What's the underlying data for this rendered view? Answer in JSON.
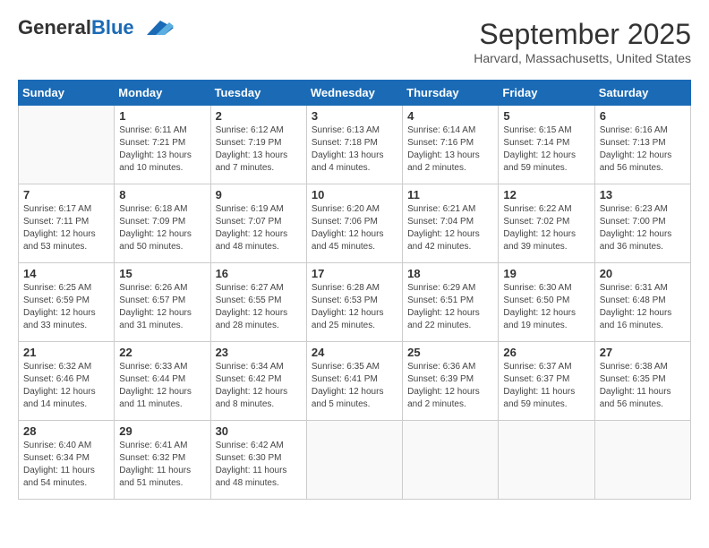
{
  "logo": {
    "general": "General",
    "blue": "Blue"
  },
  "title": "September 2025",
  "location": "Harvard, Massachusetts, United States",
  "days_of_week": [
    "Sunday",
    "Monday",
    "Tuesday",
    "Wednesday",
    "Thursday",
    "Friday",
    "Saturday"
  ],
  "weeks": [
    [
      {
        "day": "",
        "sunrise": "",
        "sunset": "",
        "daylight": ""
      },
      {
        "day": "1",
        "sunrise": "Sunrise: 6:11 AM",
        "sunset": "Sunset: 7:21 PM",
        "daylight": "Daylight: 13 hours and 10 minutes."
      },
      {
        "day": "2",
        "sunrise": "Sunrise: 6:12 AM",
        "sunset": "Sunset: 7:19 PM",
        "daylight": "Daylight: 13 hours and 7 minutes."
      },
      {
        "day": "3",
        "sunrise": "Sunrise: 6:13 AM",
        "sunset": "Sunset: 7:18 PM",
        "daylight": "Daylight: 13 hours and 4 minutes."
      },
      {
        "day": "4",
        "sunrise": "Sunrise: 6:14 AM",
        "sunset": "Sunset: 7:16 PM",
        "daylight": "Daylight: 13 hours and 2 minutes."
      },
      {
        "day": "5",
        "sunrise": "Sunrise: 6:15 AM",
        "sunset": "Sunset: 7:14 PM",
        "daylight": "Daylight: 12 hours and 59 minutes."
      },
      {
        "day": "6",
        "sunrise": "Sunrise: 6:16 AM",
        "sunset": "Sunset: 7:13 PM",
        "daylight": "Daylight: 12 hours and 56 minutes."
      }
    ],
    [
      {
        "day": "7",
        "sunrise": "Sunrise: 6:17 AM",
        "sunset": "Sunset: 7:11 PM",
        "daylight": "Daylight: 12 hours and 53 minutes."
      },
      {
        "day": "8",
        "sunrise": "Sunrise: 6:18 AM",
        "sunset": "Sunset: 7:09 PM",
        "daylight": "Daylight: 12 hours and 50 minutes."
      },
      {
        "day": "9",
        "sunrise": "Sunrise: 6:19 AM",
        "sunset": "Sunset: 7:07 PM",
        "daylight": "Daylight: 12 hours and 48 minutes."
      },
      {
        "day": "10",
        "sunrise": "Sunrise: 6:20 AM",
        "sunset": "Sunset: 7:06 PM",
        "daylight": "Daylight: 12 hours and 45 minutes."
      },
      {
        "day": "11",
        "sunrise": "Sunrise: 6:21 AM",
        "sunset": "Sunset: 7:04 PM",
        "daylight": "Daylight: 12 hours and 42 minutes."
      },
      {
        "day": "12",
        "sunrise": "Sunrise: 6:22 AM",
        "sunset": "Sunset: 7:02 PM",
        "daylight": "Daylight: 12 hours and 39 minutes."
      },
      {
        "day": "13",
        "sunrise": "Sunrise: 6:23 AM",
        "sunset": "Sunset: 7:00 PM",
        "daylight": "Daylight: 12 hours and 36 minutes."
      }
    ],
    [
      {
        "day": "14",
        "sunrise": "Sunrise: 6:25 AM",
        "sunset": "Sunset: 6:59 PM",
        "daylight": "Daylight: 12 hours and 33 minutes."
      },
      {
        "day": "15",
        "sunrise": "Sunrise: 6:26 AM",
        "sunset": "Sunset: 6:57 PM",
        "daylight": "Daylight: 12 hours and 31 minutes."
      },
      {
        "day": "16",
        "sunrise": "Sunrise: 6:27 AM",
        "sunset": "Sunset: 6:55 PM",
        "daylight": "Daylight: 12 hours and 28 minutes."
      },
      {
        "day": "17",
        "sunrise": "Sunrise: 6:28 AM",
        "sunset": "Sunset: 6:53 PM",
        "daylight": "Daylight: 12 hours and 25 minutes."
      },
      {
        "day": "18",
        "sunrise": "Sunrise: 6:29 AM",
        "sunset": "Sunset: 6:51 PM",
        "daylight": "Daylight: 12 hours and 22 minutes."
      },
      {
        "day": "19",
        "sunrise": "Sunrise: 6:30 AM",
        "sunset": "Sunset: 6:50 PM",
        "daylight": "Daylight: 12 hours and 19 minutes."
      },
      {
        "day": "20",
        "sunrise": "Sunrise: 6:31 AM",
        "sunset": "Sunset: 6:48 PM",
        "daylight": "Daylight: 12 hours and 16 minutes."
      }
    ],
    [
      {
        "day": "21",
        "sunrise": "Sunrise: 6:32 AM",
        "sunset": "Sunset: 6:46 PM",
        "daylight": "Daylight: 12 hours and 14 minutes."
      },
      {
        "day": "22",
        "sunrise": "Sunrise: 6:33 AM",
        "sunset": "Sunset: 6:44 PM",
        "daylight": "Daylight: 12 hours and 11 minutes."
      },
      {
        "day": "23",
        "sunrise": "Sunrise: 6:34 AM",
        "sunset": "Sunset: 6:42 PM",
        "daylight": "Daylight: 12 hours and 8 minutes."
      },
      {
        "day": "24",
        "sunrise": "Sunrise: 6:35 AM",
        "sunset": "Sunset: 6:41 PM",
        "daylight": "Daylight: 12 hours and 5 minutes."
      },
      {
        "day": "25",
        "sunrise": "Sunrise: 6:36 AM",
        "sunset": "Sunset: 6:39 PM",
        "daylight": "Daylight: 12 hours and 2 minutes."
      },
      {
        "day": "26",
        "sunrise": "Sunrise: 6:37 AM",
        "sunset": "Sunset: 6:37 PM",
        "daylight": "Daylight: 11 hours and 59 minutes."
      },
      {
        "day": "27",
        "sunrise": "Sunrise: 6:38 AM",
        "sunset": "Sunset: 6:35 PM",
        "daylight": "Daylight: 11 hours and 56 minutes."
      }
    ],
    [
      {
        "day": "28",
        "sunrise": "Sunrise: 6:40 AM",
        "sunset": "Sunset: 6:34 PM",
        "daylight": "Daylight: 11 hours and 54 minutes."
      },
      {
        "day": "29",
        "sunrise": "Sunrise: 6:41 AM",
        "sunset": "Sunset: 6:32 PM",
        "daylight": "Daylight: 11 hours and 51 minutes."
      },
      {
        "day": "30",
        "sunrise": "Sunrise: 6:42 AM",
        "sunset": "Sunset: 6:30 PM",
        "daylight": "Daylight: 11 hours and 48 minutes."
      },
      {
        "day": "",
        "sunrise": "",
        "sunset": "",
        "daylight": ""
      },
      {
        "day": "",
        "sunrise": "",
        "sunset": "",
        "daylight": ""
      },
      {
        "day": "",
        "sunrise": "",
        "sunset": "",
        "daylight": ""
      },
      {
        "day": "",
        "sunrise": "",
        "sunset": "",
        "daylight": ""
      }
    ]
  ]
}
